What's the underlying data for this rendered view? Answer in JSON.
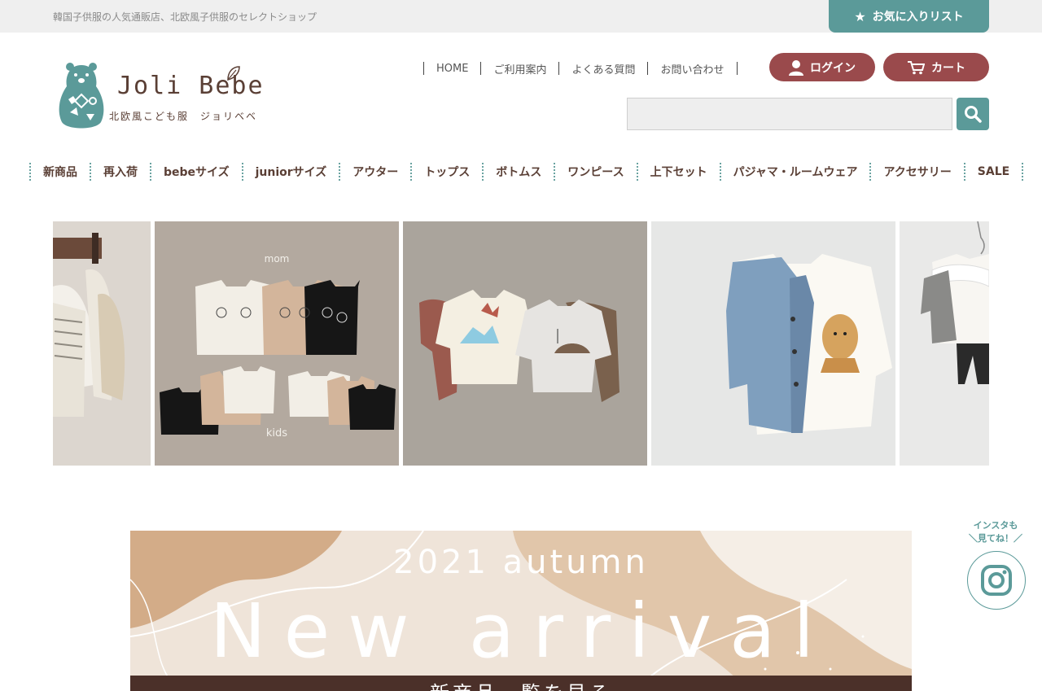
{
  "topbar": {
    "tagline": "韓国子供服の人気通販店、北欧風子供服のセレクトショップ",
    "favorites_label": "お気に入りリスト",
    "favorites_icon": "star-icon"
  },
  "logo": {
    "name": "Joli Bebe",
    "subtitle": "北欧風こども服　ジョリベベ"
  },
  "header_nav": {
    "items": [
      "HOME",
      "ご利用案内",
      "よくある質問",
      "お問い合わせ"
    ]
  },
  "account": {
    "login_label": "ログイン",
    "cart_label": "カート"
  },
  "search": {
    "value": "",
    "placeholder": ""
  },
  "category_nav": {
    "items": [
      "新商品",
      "再入荷",
      "bebeサイズ",
      "juniorサイズ",
      "アウター",
      "トップス",
      "ボトムス",
      "ワンピース",
      "上下セット",
      "パジャマ・ルームウェア",
      "アクセサリー",
      "SALE"
    ]
  },
  "slider": {
    "slides": [
      {
        "caption_top": "",
        "caption_bottom": ""
      },
      {
        "caption_top": "mom",
        "caption_bottom": "kids"
      },
      {
        "caption_top": "",
        "caption_bottom": ""
      },
      {
        "caption_top": "",
        "caption_bottom": ""
      },
      {
        "caption_top": "",
        "caption_bottom": ""
      }
    ]
  },
  "banner": {
    "year": "2021 autumn",
    "title": "New arrival",
    "cta": "新商品一覧を見る"
  },
  "instagram": {
    "label_line1": "インスタも",
    "label_line2": "＼見てね！／"
  },
  "colors": {
    "teal": "#5b9a99",
    "burgundy": "#9a4a4c",
    "brown": "#5a3f35",
    "topbar_bg": "#efefef"
  }
}
